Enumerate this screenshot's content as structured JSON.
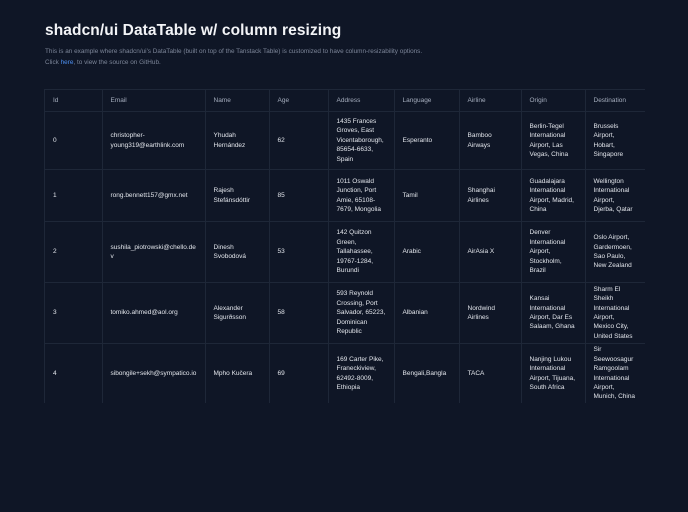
{
  "header": {
    "title": "shadcn/ui DataTable w/ column resizing",
    "description": "This is an example where shadcn/ui's DataTable (built on top of the Tanstack Table) is customized to have column-resizability options.",
    "link_prefix": "Click ",
    "link_text": "here",
    "link_suffix": ", to view the source on GitHub."
  },
  "table": {
    "columns": [
      "Id",
      "Email",
      "Name",
      "Age",
      "Address",
      "Language",
      "Airline",
      "Origin",
      "Destination"
    ],
    "rows": [
      {
        "id": "0",
        "email": "christopher-young319@earthlink.com",
        "name": "Yhudah Hernández",
        "age": "62",
        "address": "1435 Frances Groves, East Vicentaborough, 85654-6633, Spain",
        "language": "Esperanto",
        "airline": "Bamboo Airways",
        "origin": "Berlin-Tegel International Airport, Las Vegas, China",
        "destination": "Brussels Airport, Hobart, Singapore"
      },
      {
        "id": "1",
        "email": "rong.bennett157@gmx.net",
        "name": "Rajesh Stefánsdóttir",
        "age": "85",
        "address": "1011 Oswald Junction, Port Amie, 65108-7679, Mongolia",
        "language": "Tamil",
        "airline": "Shanghai Airlines",
        "origin": "Guadalajara International Airport, Madrid, China",
        "destination": "Wellington International Airport, Djerba, Qatar"
      },
      {
        "id": "2",
        "email": "sushila_piotrowski@chello.dev",
        "name": "Dinesh Svobodová",
        "age": "53",
        "address": "142 Quitzon Green, Tallahassee, 19767-1284, Burundi",
        "language": "Arabic",
        "airline": "AirAsia X",
        "origin": "Denver International Airport, Stockholm, Brazil",
        "destination": "Oslo Airport, Gardermoen, Sao Paulo, New Zealand"
      },
      {
        "id": "3",
        "email": "tomiko.ahmed@aol.org",
        "name": "Alexander Sigurðsson",
        "age": "58",
        "address": "593 Reynold Crossing, Port Salvador, 65223, Dominican Republic",
        "language": "Albanian",
        "airline": "Nordwind Airlines",
        "origin": "Kansai International Airport, Dar Es Salaam, Ghana",
        "destination": "Sharm El Sheikh International Airport, Mexico City, United States"
      },
      {
        "id": "4",
        "email": "sibongile+sekh@sympatico.io",
        "name": "Mpho Kučera",
        "age": "69",
        "address": "169 Carter Pike, Franeckiview, 62492-8009, Ethiopia",
        "language": "Bengali,Bangla",
        "airline": "TACA",
        "origin": "Nanjing Lukou International Airport, Tijuana, South Africa",
        "destination": "Sir Seewoosagur Ramgoolam International Airport, Munich, China"
      }
    ]
  }
}
